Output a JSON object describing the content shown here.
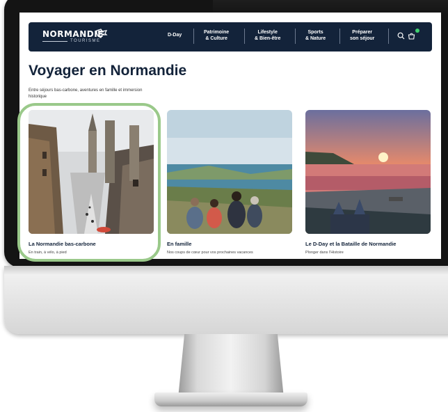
{
  "site": {
    "logo_text": "NORMANDIE",
    "logo_sub": "TOURISME"
  },
  "nav": {
    "items": [
      {
        "line1": "D-Day",
        "line2": ""
      },
      {
        "line1": "Patrimoine",
        "line2": "& Culture"
      },
      {
        "line1": "Lifestyle",
        "line2": "& Bien-être"
      },
      {
        "line1": "Sports",
        "line2": "& Nature"
      },
      {
        "line1": "Préparer",
        "line2": "son séjour"
      }
    ],
    "icons": [
      "search-icon",
      "cart-icon"
    ],
    "cart_badge_color": "#3fd16f"
  },
  "page": {
    "title": "Voyager en Normandie",
    "intro": "Entre séjours bas-carbone, aventures en famille et immersion historique"
  },
  "cards": [
    {
      "title": "La Normandie bas-carbone",
      "subtitle": "En train, à vélo, à pied"
    },
    {
      "title": "En famille",
      "subtitle": "Nos coups de cœur pour vos prochaines vacances"
    },
    {
      "title": "Le D-Day et la Bataille de Normandie",
      "subtitle": "Plonger dans l'Histoire"
    }
  ],
  "colors": {
    "navbar": "#13233a",
    "highlight_ring": "#9ac98a",
    "title": "#13233a"
  }
}
